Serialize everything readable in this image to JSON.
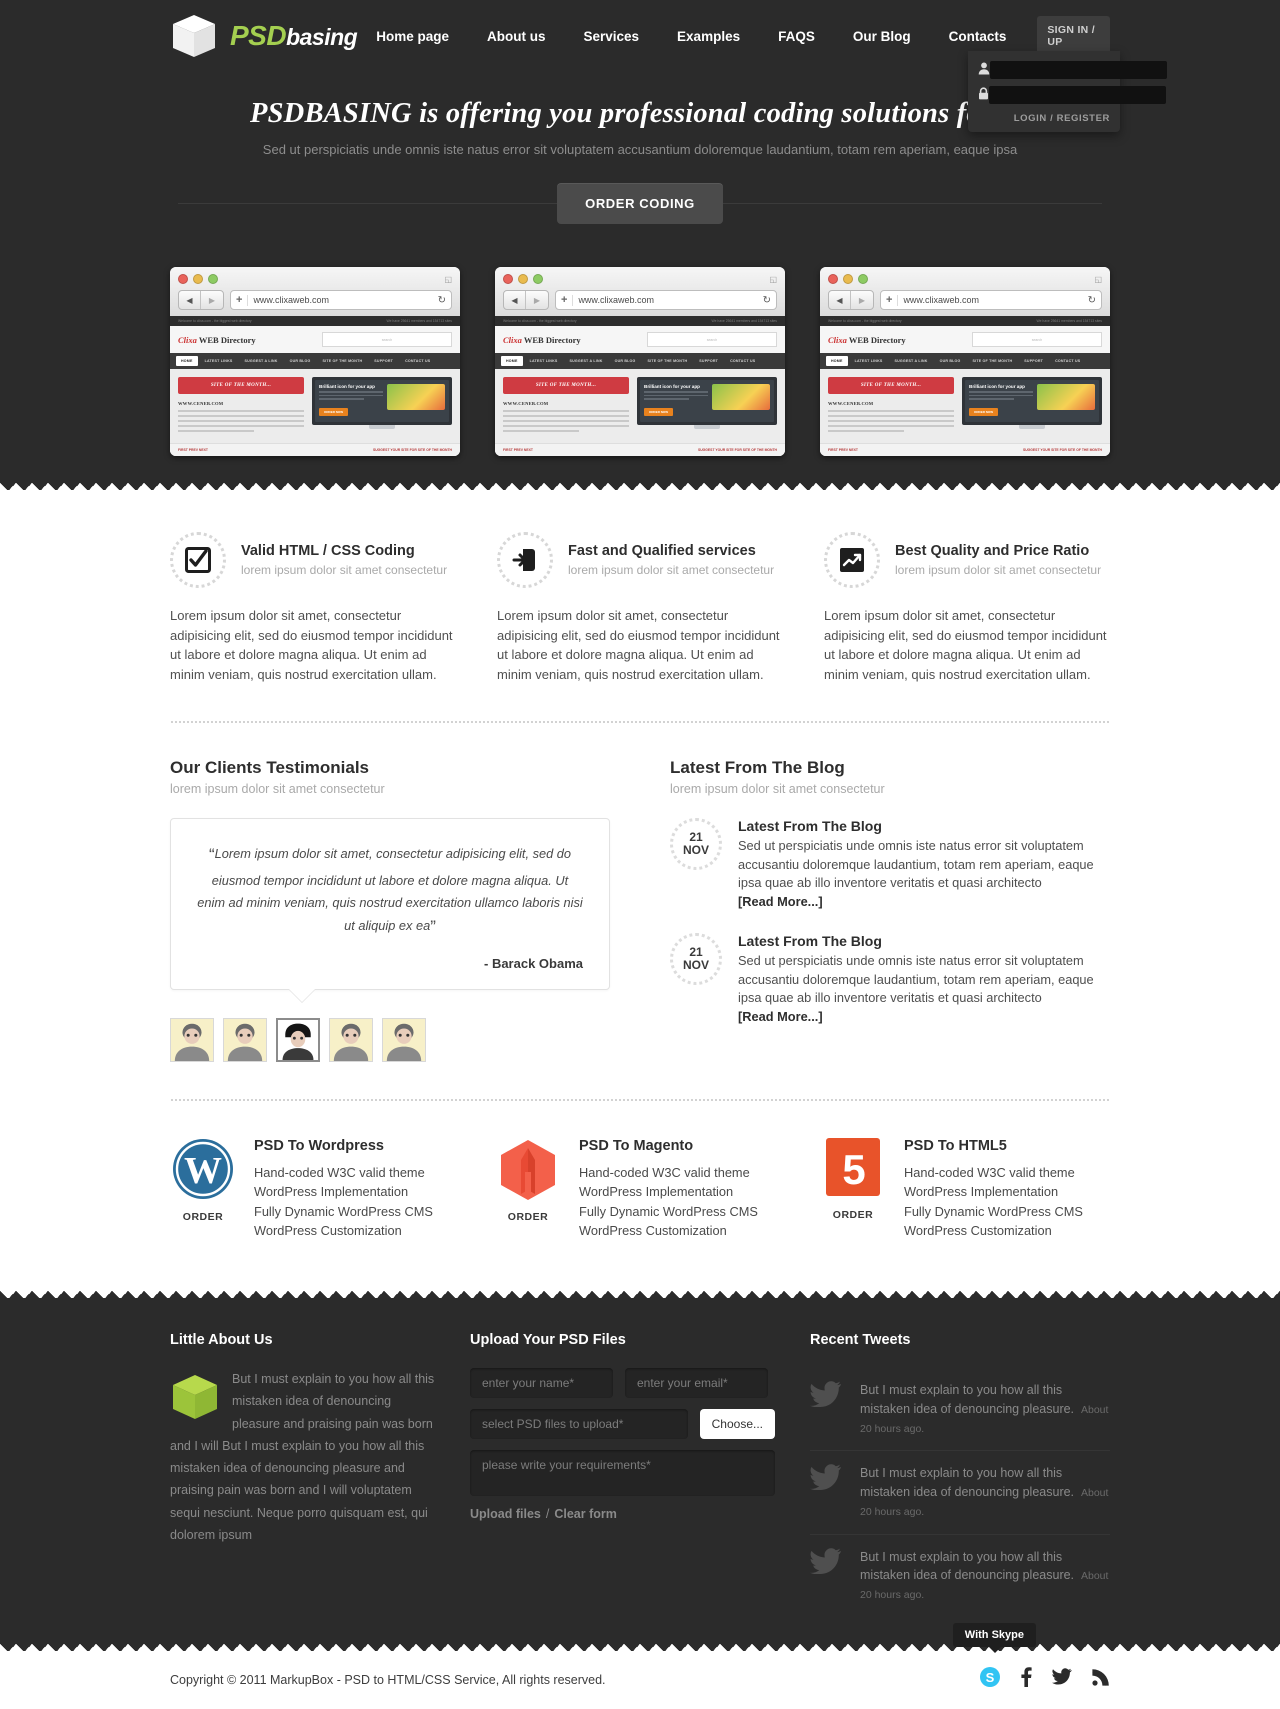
{
  "brand": {
    "part1": "PSD",
    "part2": "basing",
    "accent": "#a4cf50"
  },
  "nav": {
    "items": [
      {
        "label": "Home page"
      },
      {
        "label": "About us"
      },
      {
        "label": "Services"
      },
      {
        "label": "Examples"
      },
      {
        "label": "FAQS"
      },
      {
        "label": "Our Blog"
      },
      {
        "label": "Contacts"
      }
    ],
    "signin_label": "SIGN IN / UP"
  },
  "login_dropdown": {
    "username_placeholder": "",
    "password_placeholder": "",
    "login_label": "LOGIN",
    "separator": "/",
    "register_label": "REGISTER"
  },
  "hero": {
    "headline": "PSDBASING is offering you professional coding solutions for an",
    "subline": "Sed ut perspiciatis unde omnis iste natus error sit voluptatem accusantium doloremque laudantium, totam rem aperiam, eaque ipsa",
    "cta": "ORDER CODING"
  },
  "mockups": [
    {
      "url": "www.clixaweb.com",
      "topbar_left": "Welcome to clixa.com - the biggest web directory",
      "topbar_right": "We have 25641 members and 154713 sites",
      "logo_italic": "Clixa",
      "logo_rest": "WEB Directory",
      "search_placeholder": "search",
      "nav": [
        "HOME",
        "LATEST LINKS",
        "SUGGEST A LINK",
        "OUR BLOG",
        "SITE OF THE MONTH",
        "SUPPORT",
        "CONTACT US"
      ],
      "badge": "SITE OF THE MONTH...",
      "subhead": "WWW.CENEB.COM",
      "monitor_title": "Brilliant icon for your app",
      "monitor_btn": "ORDER NOW",
      "foot_left": "FIRST PREV NEXT",
      "foot_right": "SUGGEST YOUR SITE FOR SITE OF THE MONTH"
    },
    {
      "url": "www.clixaweb.com",
      "topbar_left": "Welcome to clixa.com - the biggest web directory",
      "topbar_right": "We have 25641 members and 154713 sites",
      "logo_italic": "Clixa",
      "logo_rest": "WEB Directory",
      "search_placeholder": "search",
      "nav": [
        "HOME",
        "LATEST LINKS",
        "SUGGEST A LINK",
        "OUR BLOG",
        "SITE OF THE MONTH",
        "SUPPORT",
        "CONTACT US"
      ],
      "badge": "SITE OF THE MONTH...",
      "subhead": "WWW.CENEB.COM",
      "monitor_title": "Brilliant icon for your app",
      "monitor_btn": "ORDER NOW",
      "foot_left": "FIRST PREV NEXT",
      "foot_right": "SUGGEST YOUR SITE FOR SITE OF THE MONTH"
    },
    {
      "url": "www.clixaweb.com",
      "topbar_left": "Welcome to clixa.com - the biggest web directory",
      "topbar_right": "We have 25641 members and 154713 sites",
      "logo_italic": "Clixa",
      "logo_rest": "WEB Directory",
      "search_placeholder": "search",
      "nav": [
        "HOME",
        "LATEST LINKS",
        "SUGGEST A LINK",
        "OUR BLOG",
        "SITE OF THE MONTH",
        "SUPPORT",
        "CONTACT US"
      ],
      "badge": "SITE OF THE MONTH...",
      "subhead": "WWW.CENEB.COM",
      "monitor_title": "Brilliant icon for your app",
      "monitor_btn": "ORDER NOW",
      "foot_left": "FIRST PREV NEXT",
      "foot_right": "SUGGEST YOUR SITE FOR SITE OF THE MONTH"
    }
  ],
  "features": [
    {
      "icon": "checkbox-icon",
      "title": "Valid HTML / CSS Coding",
      "subtitle": "lorem ipsum dolor sit amet consectetur",
      "body": "Lorem ipsum dolor sit amet, consectetur adipisicing elit, sed do eiusmod tempor incididunt ut labore et dolore magna aliqua. Ut enim ad minim veniam, quis nostrud exercitation ullam."
    },
    {
      "icon": "arrow-page-icon",
      "title": "Fast and Qualified services",
      "subtitle": "lorem ipsum dolor sit amet consectetur",
      "body": "Lorem ipsum dolor sit amet, consectetur adipisicing elit, sed do eiusmod tempor incididunt ut labore et dolore magna aliqua. Ut enim ad minim veniam, quis nostrud exercitation ullam."
    },
    {
      "icon": "chart-arrow-icon",
      "title": "Best Quality and Price Ratio",
      "subtitle": "lorem ipsum dolor sit amet consectetur",
      "body": "Lorem ipsum dolor sit amet, consectetur adipisicing elit, sed do eiusmod tempor incididunt ut labore et dolore magna aliqua. Ut enim ad minim veniam, quis nostrud exercitation ullam."
    }
  ],
  "testimonials": {
    "title": "Our Clients Testimonials",
    "subtitle": "lorem ipsum dolor sit amet consectetur",
    "quote": "Lorem ipsum dolor sit amet, consectetur adipisicing elit, sed do eiusmod tempor incididunt ut labore et dolore magna aliqua. Ut enim ad minim veniam, quis nostrud exercitation ullamco laboris nisi ut aliquip ex ea",
    "open_quote": "“",
    "close_quote": "”",
    "author": "- Barack Obama",
    "avatars": [
      {
        "name": "avatar-1",
        "selected": false
      },
      {
        "name": "avatar-2",
        "selected": false
      },
      {
        "name": "avatar-3",
        "selected": true
      },
      {
        "name": "avatar-4",
        "selected": false
      },
      {
        "name": "avatar-5",
        "selected": false
      }
    ]
  },
  "blog": {
    "title": "Latest From The Blog",
    "subtitle": "lorem ipsum dolor sit amet consectetur",
    "posts": [
      {
        "day": "21",
        "month": "NOV",
        "heading": "Latest From The Blog",
        "excerpt": "Sed ut perspiciatis unde omnis iste natus error sit voluptatem accusantiu doloremque laudantium, totam rem aperiam, eaque ipsa quae ab illo inventore veritatis et quasi architecto",
        "readmore": "[Read More...]"
      },
      {
        "day": "21",
        "month": "NOV",
        "heading": "Latest From The Blog",
        "excerpt": "Sed ut perspiciatis unde omnis iste natus error sit voluptatem accusantiu doloremque laudantium, totam rem aperiam, eaque ipsa quae ab illo inventore veritatis et quasi architecto",
        "readmore": "[Read More...]"
      }
    ]
  },
  "services": [
    {
      "logo": "wordpress-logo",
      "order_label": "ORDER",
      "title": "PSD To Wordpress",
      "items": [
        "Hand-coded W3C valid theme",
        "WordPress Implementation",
        "Fully Dynamic WordPress CMS",
        "WordPress Customization"
      ]
    },
    {
      "logo": "magento-logo",
      "order_label": "ORDER",
      "title": "PSD To Magento",
      "items": [
        "Hand-coded W3C valid theme",
        "WordPress Implementation",
        "Fully Dynamic WordPress CMS",
        "WordPress Customization"
      ]
    },
    {
      "logo": "html5-logo",
      "order_label": "ORDER",
      "title": "PSD To HTML5",
      "items": [
        "Hand-coded W3C valid theme",
        "WordPress Implementation",
        "Fully Dynamic WordPress CMS",
        "WordPress Customization"
      ]
    }
  ],
  "footer": {
    "about": {
      "title": "Little About Us",
      "text": "But I must explain to you how all this mistaken idea of denouncing pleasure and praising pain was born and I will But I must explain to you how all this mistaken idea of denouncing pleasure and praising pain was born and I will voluptatem sequi nesciunt. Neque porro quisquam est, qui dolorem ipsum"
    },
    "upload": {
      "title": "Upload Your PSD Files",
      "name_placeholder": "enter your name*",
      "email_placeholder": "enter your email*",
      "file_placeholder": "select PSD files to upload*",
      "choose_label": "Choose...",
      "requirements_placeholder": "please write your requirements*",
      "upload_label": "Upload files",
      "separator": "/",
      "clear_label": "Clear form"
    },
    "tweets": {
      "title": "Recent Tweets",
      "items": [
        {
          "text": "But I must explain to you how all this mistaken idea of denouncing pleasure.",
          "time": "About 20 hours ago."
        },
        {
          "text": "But I must explain to you how all this mistaken idea of denouncing pleasure.",
          "time": "About 20 hours ago."
        },
        {
          "text": "But I must explain to you how all this mistaken idea of denouncing pleasure.",
          "time": "About 20 hours ago."
        }
      ]
    }
  },
  "bottom": {
    "copyright": "Copyright © 2011 MarkupBox - PSD to HTML/CSS Service, All rights reserved.",
    "skype_tooltip": "With Skype",
    "socials": [
      {
        "name": "skype-icon",
        "color": "#31c4f3"
      },
      {
        "name": "facebook-icon",
        "color": "#2b2b2b"
      },
      {
        "name": "twitter-icon",
        "color": "#2b2b2b"
      },
      {
        "name": "rss-icon",
        "color": "#2b2b2b"
      }
    ]
  }
}
